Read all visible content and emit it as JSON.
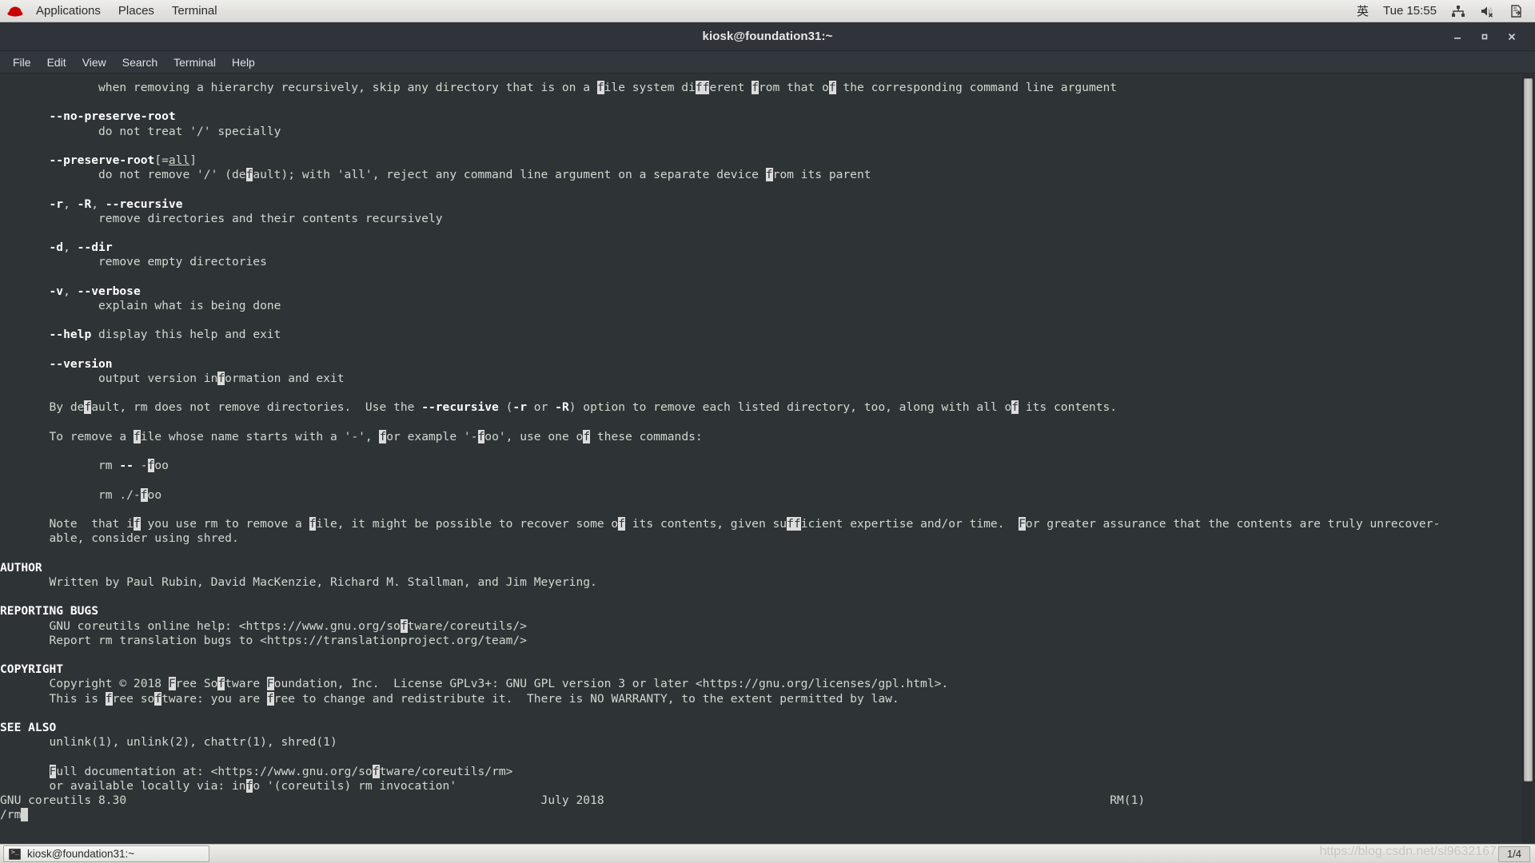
{
  "top_panel": {
    "logo": "redhat-logo",
    "menus": [
      "Applications",
      "Places",
      "Terminal"
    ],
    "ime": "英",
    "clock": "Tue 15:55",
    "tray_icons": [
      "network-icon",
      "volume-muted-icon",
      "power-document-icon"
    ]
  },
  "window": {
    "title": "kiosk@foundation31:~",
    "buttons": {
      "minimize": "minimize-button",
      "maximize": "maximize-button",
      "close": "close-button"
    },
    "menubar": [
      "File",
      "Edit",
      "View",
      "Search",
      "Terminal",
      "Help"
    ]
  },
  "terminal": {
    "program": "man rm (less pager)",
    "search_term": "f",
    "prompt": "/rm",
    "footer": {
      "left": "GNU coreutils 8.30",
      "center": "July 2018",
      "right": "RM(1)"
    },
    "lines": [
      "              when removing a hierarchy recursively, skip any directory that is on a file system different from that of the corresponding command line argument",
      "",
      "       --no-preserve-root",
      "              do not treat '/' specially",
      "",
      "       --preserve-root[=all]",
      "              do not remove '/' (default); with 'all', reject any command line argument on a separate device from its parent",
      "",
      "       -r, -R, --recursive",
      "              remove directories and their contents recursively",
      "",
      "       -d, --dir",
      "              remove empty directories",
      "",
      "       -v, --verbose",
      "              explain what is being done",
      "",
      "       --help display this help and exit",
      "",
      "       --version",
      "              output version information and exit",
      "",
      "       By default, rm does not remove directories.  Use the --recursive (-r or -R) option to remove each listed directory, too, along with all of its contents.",
      "",
      "       To remove a file whose name starts with a '-', for example '-foo', use one of these commands:",
      "",
      "              rm -- -foo",
      "",
      "              rm ./-foo",
      "",
      "       Note  that if you use rm to remove a file, it might be possible to recover some of its contents, given sufficient expertise and/or time.  For greater assurance that the contents are truly unrecover-",
      "       able, consider using shred.",
      "",
      "AUTHOR",
      "       Written by Paul Rubin, David MacKenzie, Richard M. Stallman, and Jim Meyering.",
      "",
      "REPORTING BUGS",
      "       GNU coreutils online help: <https://www.gnu.org/software/coreutils/>",
      "       Report rm translation bugs to <https://translationproject.org/team/>",
      "",
      "COPYRIGHT",
      "       Copyright © 2018 Free Software Foundation, Inc.  License GPLv3+: GNU GPL version 3 or later <https://gnu.org/licenses/gpl.html>.",
      "       This is free software: you are free to change and redistribute it.  There is NO WARRANTY, to the extent permitted by law.",
      "",
      "SEE ALSO",
      "       unlink(1), unlink(2), chattr(1), shred(1)",
      "",
      "       Full documentation at: <https://www.gnu.org/software/coreutils/rm>",
      "       or available locally via: info '(coreutils) rm invocation'"
    ]
  },
  "taskbar": {
    "window_button": "kiosk@foundation31:~",
    "window_icon": "terminal-icon",
    "watermark": "https://blog.csdn.net/sl9632167",
    "workspace": "1/4"
  }
}
